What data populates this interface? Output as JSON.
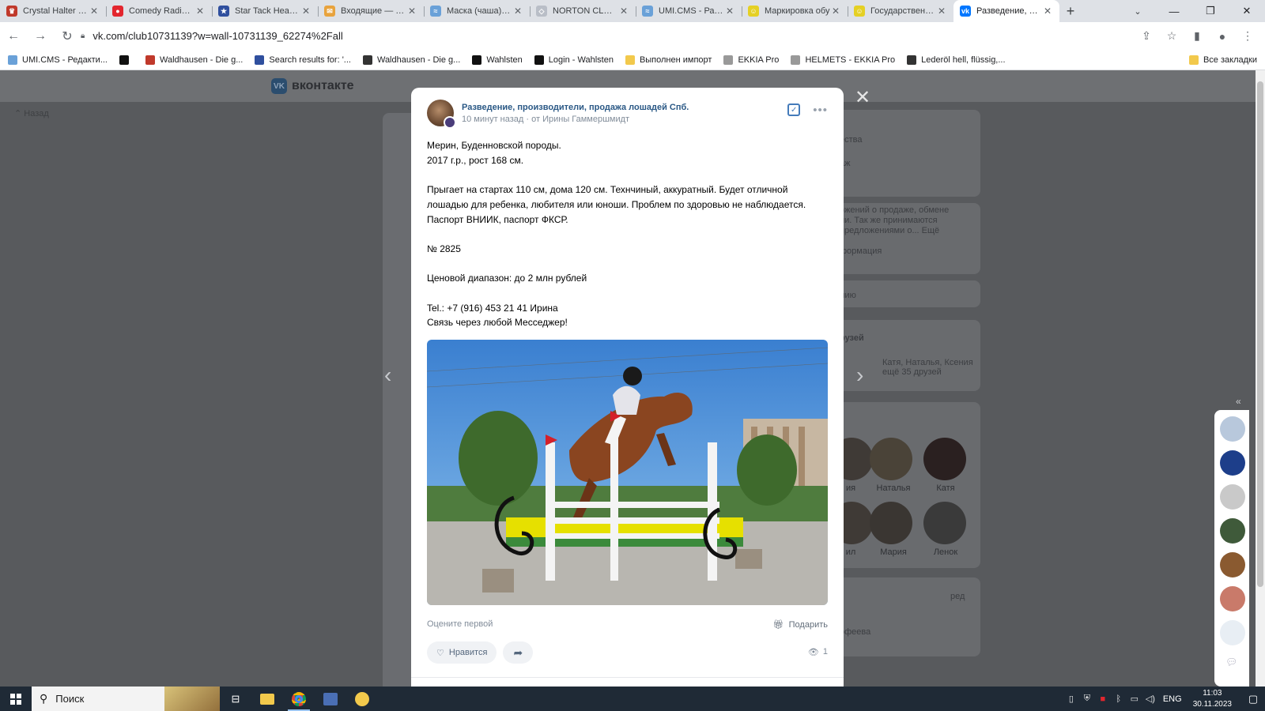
{
  "browser": {
    "tabs": [
      {
        "title": "Crystal Halter | Ful",
        "color": "#c0392b",
        "glyph": "♛"
      },
      {
        "title": "Comedy Radio —",
        "color": "#e3262e",
        "glyph": "●"
      },
      {
        "title": "Star Tack Head po",
        "color": "#2f4f9e",
        "glyph": "★"
      },
      {
        "title": "Входящие — Янд",
        "color": "#e8a33d",
        "glyph": "✉"
      },
      {
        "title": "Маска (чаша) для",
        "color": "#6aa1d8",
        "glyph": "≈"
      },
      {
        "title": "NORTON CLUB \"R",
        "color": "#b9bec7",
        "glyph": "◇"
      },
      {
        "title": "UMI.CMS - Разде",
        "color": "#6aa1d8",
        "glyph": "≈"
      },
      {
        "title": "Маркировка обу",
        "color": "#e5d024",
        "glyph": "☺"
      },
      {
        "title": "Государственная",
        "color": "#e5d024",
        "glyph": "☺"
      },
      {
        "title": "Разведение, про",
        "color": "#0077ff",
        "glyph": "vk"
      }
    ],
    "active_tab_index": 9,
    "url": "vk.com/club10731139?w=wall-10731139_62274%2Fall",
    "bookmarks": [
      {
        "label": "UMI.CMS - Редакти...",
        "color": "#6aa1d8"
      },
      {
        "label": "",
        "color": "#111111"
      },
      {
        "label": "Waldhausen - Die g...",
        "color": "#c0392b"
      },
      {
        "label": "Search results for: '...",
        "color": "#2f4f9e"
      },
      {
        "label": "Waldhausen - Die g...",
        "color": "#333333"
      },
      {
        "label": "Wahlsten",
        "color": "#111111"
      },
      {
        "label": "Login - Wahlsten",
        "color": "#111111"
      },
      {
        "label": "Выполнен импорт",
        "color": "#f2c94c"
      },
      {
        "label": "EKKIA Pro",
        "color": "#999999"
      },
      {
        "label": "HELMETS - EKKIA Pro",
        "color": "#999999"
      },
      {
        "label": "Lederöl hell, flüssig,...",
        "color": "#333333"
      }
    ],
    "bookmarks_all": "Все закладки"
  },
  "vk": {
    "logo_text": "вконтакте",
    "back_label": "Назад",
    "dimmed_bg": {
      "right_lines": [
        "ества",
        "аж",
        "ожений о продаже, обмене",
        "ии. Так же принимаются",
        "предложениями о... Ещё",
        "формация",
        "лию",
        "рузей",
        "Катя, Наталья, Ксения",
        "ещё 35 друзей",
        "ред",
        "офеева"
      ],
      "friends": [
        "ия",
        "Наталья",
        "Катя",
        "ил",
        "Мария",
        "Ленок"
      ]
    }
  },
  "post": {
    "group_name": "Разведение, производители, продажа лошадей Спб.",
    "time": "10 минут назад",
    "author": "от Ирины Гаммершмидт",
    "lines": [
      "Мерин, Буденновской породы.",
      "2017 г.р., рост 168 см.",
      "",
      "Прыгает на стартах 110 см, дома 120 см. Технчиный, аккуратный. Будет отличной лошадью для ребенка, любителя или юноши. Проблем по здоровью не наблюдается. Паспорт ВНИИК, паспорт ФКСР.",
      "",
      "№ 2825",
      "",
      "Ценовой диапазон: до 2 млн рублей",
      "",
      "Tel.: +7 (916) 453 21 41 Ирина",
      "Связь через любой Месседжер!"
    ],
    "rate_first": "Оцените первой",
    "gift_label": "Подарить",
    "like_label": "Нравится",
    "views": "1"
  },
  "taskbar": {
    "search_placeholder": "Поиск",
    "lang": "ENG",
    "time": "11:03",
    "date": "30.11.2023"
  },
  "icons": [
    "back-icon",
    "forward-icon",
    "reload-icon",
    "lock-icon",
    "share-icon",
    "star-icon",
    "sidebar-icon",
    "profile-icon",
    "menu-icon",
    "close-icon",
    "heart-icon",
    "gift-icon",
    "eye-icon",
    "windows-icon",
    "search-icon"
  ]
}
